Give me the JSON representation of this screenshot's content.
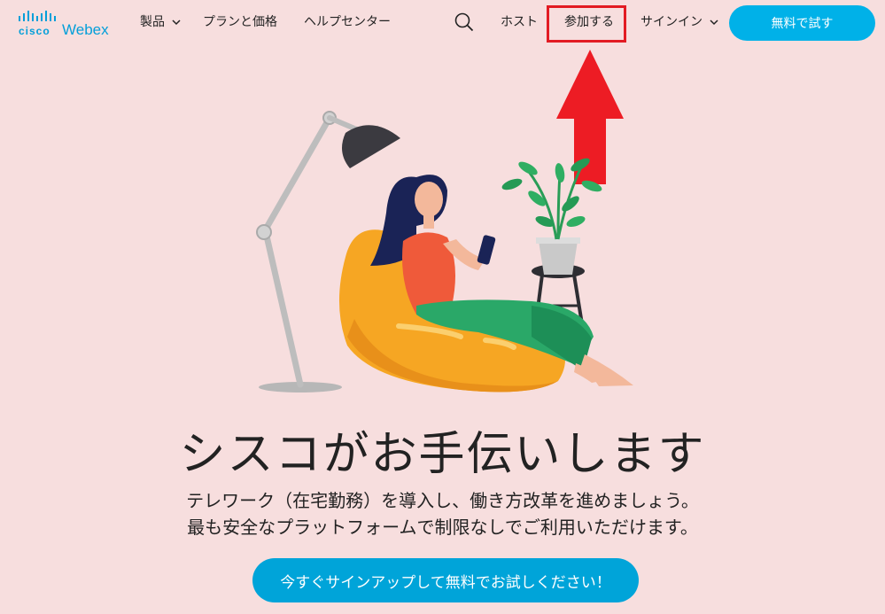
{
  "brand": {
    "cisco": "cisco",
    "product": "Webex",
    "color": "#049fd9"
  },
  "nav": {
    "products": "製品",
    "pricing": "プランと価格",
    "help": "ヘルプセンター",
    "host": "ホスト",
    "join": "参加する",
    "signin": "サインイン",
    "trial": "無料で試す"
  },
  "hero": {
    "headline": "シスコがお手伝いします",
    "sub_line1": "テレワーク（在宅勤務）を導入し、働き方改革を進めましょう。",
    "sub_line2": "最も安全なプラットフォームで制限なしでご利用いただけます。",
    "cta": "今すぐサインアップして無料でお試しください！"
  },
  "annotation": {
    "highlight_color": "#e21b23",
    "target": "参加する"
  },
  "colors": {
    "background": "#f7dede",
    "accent": "#00b1e8",
    "cta": "#00a4d9"
  }
}
